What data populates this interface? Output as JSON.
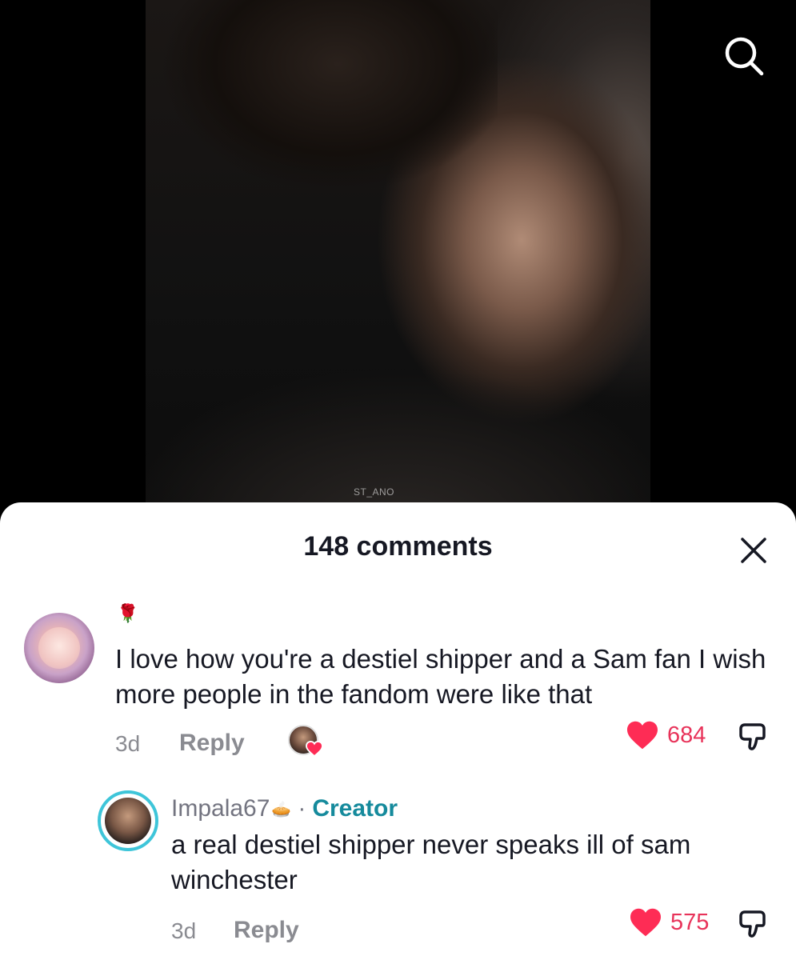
{
  "video": {
    "watermark": "ST_ANO"
  },
  "header": {
    "comments_count_label": "148 comments"
  },
  "comments": [
    {
      "badge_emoji": "🌹",
      "text": "I love how you're a destiel shipper and a Sam fan I wish more people in the fandom were like that",
      "time": "3d",
      "reply_label": "Reply",
      "likes": "684",
      "liked_by_creator": true
    },
    {
      "username": "Impala67",
      "username_emoji": "🥧",
      "separator": "·",
      "creator_label": "Creator",
      "text": "a real destiel shipper never speaks ill of sam winchester",
      "time": "3d",
      "reply_label": "Reply",
      "likes": "575"
    }
  ],
  "colors": {
    "like_red": "#e8335a",
    "creator_teal": "#158a9c",
    "avatar_ring": "#3ec5d9"
  },
  "icons": {
    "search": "search-icon",
    "close": "close-icon",
    "like": "heart-icon",
    "dislike": "thumbs-down-icon"
  }
}
